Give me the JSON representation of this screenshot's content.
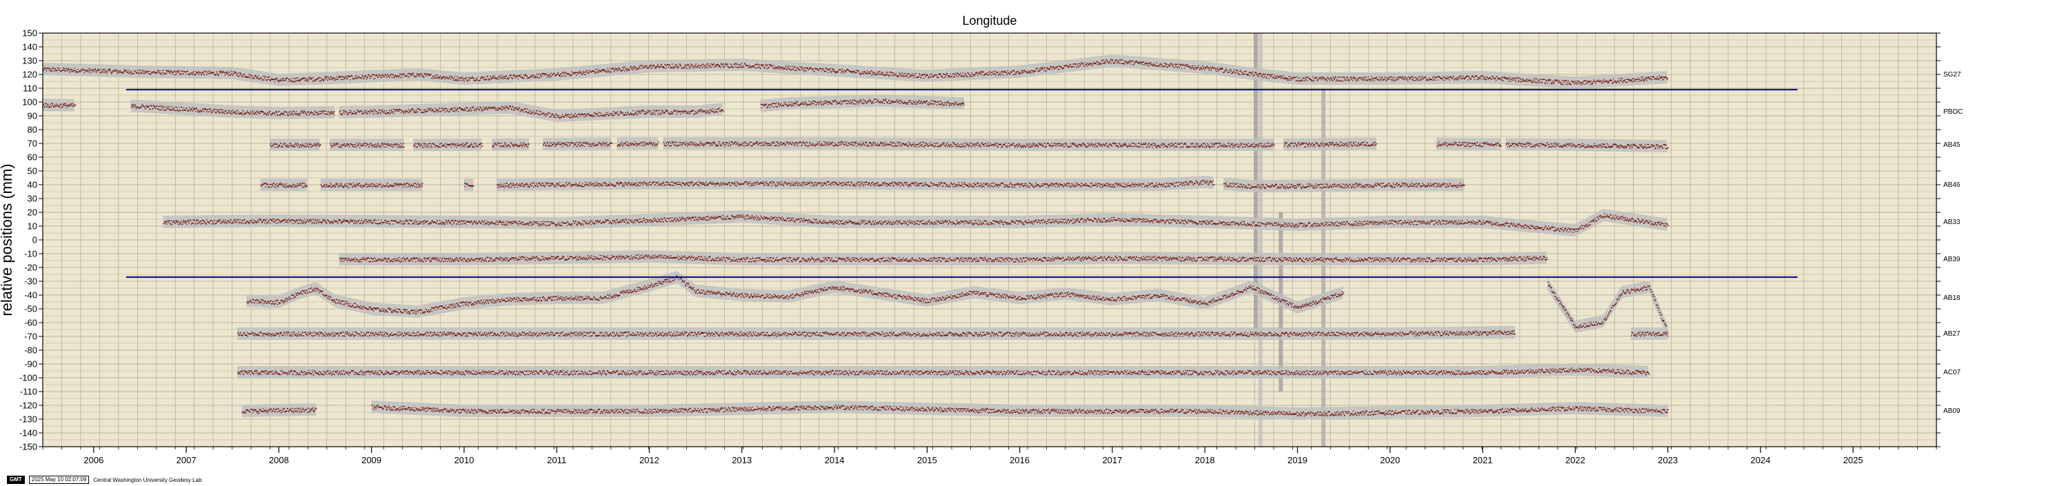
{
  "chart_data": {
    "type": "scatter",
    "title": "Longitude",
    "ylabel": "relative positions (mm)",
    "xlim": [
      2005.45,
      2025.9
    ],
    "ylim": [
      -150,
      150
    ],
    "x_ticks": [
      2006,
      2007,
      2008,
      2009,
      2010,
      2011,
      2012,
      2013,
      2014,
      2015,
      2016,
      2017,
      2018,
      2019,
      2020,
      2021,
      2022,
      2023,
      2024,
      2025
    ],
    "y_ticks": [
      150,
      140,
      130,
      120,
      110,
      100,
      90,
      80,
      70,
      60,
      50,
      40,
      30,
      20,
      10,
      0,
      -10,
      -20,
      -30,
      -40,
      -50,
      -60,
      -70,
      -80,
      -90,
      -100,
      -110,
      -120,
      -130,
      -140,
      -150
    ],
    "grid": true,
    "background_color": "#ece6cf",
    "point_color": "#6b0a0a",
    "band_color": "#bfbfbf",
    "reference_line_color": "#1a1a7a",
    "reference_lines": [
      {
        "y": 109,
        "x": [
          2006.35,
          2024.4
        ]
      },
      {
        "y": -27,
        "x": [
          2006.35,
          2024.4
        ]
      }
    ],
    "series": [
      {
        "name": "SG27",
        "offset": 120,
        "segments": [
          [
            2005.45,
            2023.0
          ]
        ],
        "wobble": [
          [
            2005.45,
            4
          ],
          [
            2006.5,
            2
          ],
          [
            2007.5,
            1
          ],
          [
            2008.0,
            -4
          ],
          [
            2009.5,
            0
          ],
          [
            2010.0,
            -3
          ],
          [
            2011.0,
            0
          ],
          [
            2012.0,
            6
          ],
          [
            2013.0,
            7
          ],
          [
            2014.0,
            3
          ],
          [
            2015.0,
            -1
          ],
          [
            2016.0,
            2
          ],
          [
            2017.0,
            10
          ],
          [
            2018.0,
            5
          ],
          [
            2018.7,
            -1
          ],
          [
            2019.0,
            -3
          ],
          [
            2020.0,
            -3
          ],
          [
            2021.0,
            -2
          ],
          [
            2022.0,
            -6
          ],
          [
            2022.5,
            -4
          ],
          [
            2023.0,
            -2
          ]
        ]
      },
      {
        "name": "PBOC",
        "offset": 93,
        "segments": [
          [
            2005.45,
            2005.8
          ],
          [
            2006.4,
            2008.6
          ],
          [
            2008.65,
            2012.8
          ],
          [
            2013.2,
            2015.4
          ]
        ],
        "wobble": [
          [
            2005.45,
            5
          ],
          [
            2006.5,
            4
          ],
          [
            2007.5,
            0
          ],
          [
            2008.0,
            -1
          ],
          [
            2009.0,
            0
          ],
          [
            2010.5,
            3
          ],
          [
            2011.0,
            -3
          ],
          [
            2012.0,
            0
          ],
          [
            2012.5,
            0
          ],
          [
            2013.5,
            6
          ],
          [
            2014.5,
            8
          ],
          [
            2015.4,
            6
          ]
        ]
      },
      {
        "name": "AB45",
        "offset": 69,
        "segments": [
          [
            2007.9,
            2008.45
          ],
          [
            2008.55,
            2009.35
          ],
          [
            2009.45,
            2010.2
          ],
          [
            2010.3,
            2010.7
          ],
          [
            2010.85,
            2011.6
          ],
          [
            2011.65,
            2012.1
          ],
          [
            2012.15,
            2018.75
          ],
          [
            2018.85,
            2019.85
          ],
          [
            2020.5,
            2021.2
          ],
          [
            2021.25,
            2023.0
          ]
        ],
        "wobble": [
          [
            2007.9,
            0
          ],
          [
            2010.0,
            0
          ],
          [
            2012.0,
            1
          ],
          [
            2014.0,
            1
          ],
          [
            2016.0,
            0
          ],
          [
            2018.5,
            0
          ],
          [
            2020.0,
            1
          ],
          [
            2022.0,
            0
          ],
          [
            2023.0,
            -1
          ]
        ]
      },
      {
        "name": "AB46",
        "offset": 40,
        "segments": [
          [
            2007.8,
            2008.3
          ],
          [
            2008.45,
            2009.55
          ],
          [
            2010.0,
            2010.1
          ],
          [
            2010.35,
            2018.1
          ],
          [
            2018.2,
            2020.8
          ]
        ],
        "wobble": [
          [
            2007.8,
            0
          ],
          [
            2010.5,
            0
          ],
          [
            2012.0,
            1
          ],
          [
            2014.0,
            1
          ],
          [
            2016.0,
            0
          ],
          [
            2017.5,
            0
          ],
          [
            2018.0,
            2
          ],
          [
            2018.5,
            -1
          ],
          [
            2020.0,
            0
          ],
          [
            2020.8,
            0
          ]
        ]
      },
      {
        "name": "AB33",
        "offset": 13,
        "segments": [
          [
            2006.75,
            2023.0
          ]
        ],
        "wobble": [
          [
            2006.75,
            0
          ],
          [
            2008.0,
            1
          ],
          [
            2010.0,
            0
          ],
          [
            2011.0,
            -1
          ],
          [
            2013.0,
            4
          ],
          [
            2014.0,
            0
          ],
          [
            2015.0,
            0
          ],
          [
            2016.0,
            0
          ],
          [
            2017.0,
            2
          ],
          [
            2018.0,
            0
          ],
          [
            2019.0,
            -2
          ],
          [
            2020.0,
            0
          ],
          [
            2021.0,
            0
          ],
          [
            2022.0,
            -6
          ],
          [
            2022.3,
            5
          ],
          [
            2023.0,
            -2
          ]
        ]
      },
      {
        "name": "AB39",
        "offset": -14,
        "segments": [
          [
            2008.65,
            2021.7
          ]
        ],
        "wobble": [
          [
            2008.65,
            0
          ],
          [
            2010.0,
            0
          ],
          [
            2012.0,
            2
          ],
          [
            2013.0,
            0
          ],
          [
            2016.0,
            0
          ],
          [
            2017.0,
            1
          ],
          [
            2019.0,
            0
          ],
          [
            2021.0,
            0
          ],
          [
            2021.7,
            1
          ]
        ]
      },
      {
        "name": "AB18",
        "offset": -42,
        "segments": [
          [
            2007.65,
            2019.5
          ],
          [
            2021.7,
            2023.0
          ]
        ],
        "wobble": [
          [
            2007.65,
            -2
          ],
          [
            2008.0,
            -3
          ],
          [
            2008.2,
            3
          ],
          [
            2008.4,
            7
          ],
          [
            2008.6,
            -2
          ],
          [
            2009.0,
            -8
          ],
          [
            2009.5,
            -10
          ],
          [
            2010.0,
            -4
          ],
          [
            2010.5,
            -1
          ],
          [
            2011.0,
            0
          ],
          [
            2011.5,
            0
          ],
          [
            2012.0,
            9
          ],
          [
            2012.3,
            15
          ],
          [
            2012.5,
            5
          ],
          [
            2013.0,
            2
          ],
          [
            2013.5,
            1
          ],
          [
            2014.0,
            8
          ],
          [
            2015.0,
            -2
          ],
          [
            2015.5,
            4
          ],
          [
            2016.0,
            0
          ],
          [
            2016.5,
            3
          ],
          [
            2017.0,
            -1
          ],
          [
            2017.5,
            2
          ],
          [
            2018.0,
            -4
          ],
          [
            2018.5,
            8
          ],
          [
            2019.0,
            -7
          ],
          [
            2019.5,
            4
          ],
          [
            2021.7,
            10
          ],
          [
            2022.0,
            -21
          ],
          [
            2022.3,
            -17
          ],
          [
            2022.5,
            4
          ],
          [
            2022.8,
            8
          ],
          [
            2023.0,
            -25
          ]
        ]
      },
      {
        "name": "AB27",
        "offset": -68,
        "segments": [
          [
            2007.55,
            2021.35
          ],
          [
            2022.6,
            2023.0
          ]
        ],
        "wobble": [
          [
            2007.55,
            0
          ],
          [
            2010.0,
            0
          ],
          [
            2012.0,
            0
          ],
          [
            2014.0,
            0
          ],
          [
            2016.0,
            0
          ],
          [
            2018.0,
            0
          ],
          [
            2020.0,
            0
          ],
          [
            2021.35,
            1
          ],
          [
            2022.6,
            0
          ],
          [
            2023.0,
            0
          ]
        ]
      },
      {
        "name": "AC07",
        "offset": -96,
        "segments": [
          [
            2007.55,
            2022.8
          ]
        ],
        "wobble": [
          [
            2007.55,
            0
          ],
          [
            2010.0,
            0
          ],
          [
            2012.0,
            0
          ],
          [
            2014.0,
            0
          ],
          [
            2016.0,
            0
          ],
          [
            2018.0,
            0
          ],
          [
            2020.0,
            0
          ],
          [
            2021.0,
            0
          ],
          [
            2022.0,
            2
          ],
          [
            2022.8,
            0
          ]
        ]
      },
      {
        "name": "AB09",
        "offset": -124,
        "segments": [
          [
            2007.6,
            2008.4
          ],
          [
            2009.0,
            2023.0
          ]
        ],
        "wobble": [
          [
            2007.6,
            0
          ],
          [
            2008.4,
            1
          ],
          [
            2009.0,
            3
          ],
          [
            2010.0,
            0
          ],
          [
            2012.0,
            0
          ],
          [
            2014.0,
            3
          ],
          [
            2016.0,
            0
          ],
          [
            2018.0,
            0
          ],
          [
            2019.0,
            -2
          ],
          [
            2021.0,
            0
          ],
          [
            2022.0,
            2
          ],
          [
            2023.0,
            0
          ]
        ]
      }
    ],
    "vertical_artifacts": [
      {
        "x": 2018.55,
        "y": [
          -70,
          150
        ],
        "color": "#9a9a9a"
      },
      {
        "x": 2018.6,
        "y": [
          -150,
          150
        ],
        "color": "#bdbdbd"
      },
      {
        "x": 2018.82,
        "y": [
          -110,
          20
        ],
        "color": "#9a9a9a"
      },
      {
        "x": 2019.28,
        "y": [
          -150,
          110
        ],
        "color": "#a8a8a8"
      }
    ]
  },
  "footer": {
    "badge": "GMT",
    "timestamp": "2025 May 10 02:07:09",
    "credit": "Central Washington University Geodesy Lab"
  }
}
